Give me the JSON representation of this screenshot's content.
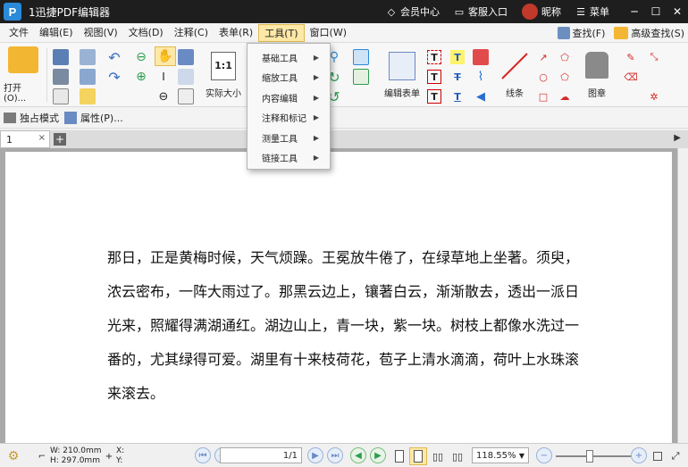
{
  "titlebar": {
    "app_title": "1迅捷PDF编辑器",
    "member_center": "会员中心",
    "customer_service": "客服入口",
    "nickname": "昵称",
    "menu_label": "菜单",
    "minimize": "─",
    "restore": "☐",
    "close": "✕"
  },
  "menubar": {
    "items": [
      "文件",
      "编辑(E)",
      "视图(V)",
      "文档(D)",
      "注释(C)",
      "表单(R)",
      "工具(T)",
      "窗口(W)"
    ],
    "find": "查找(F)",
    "advanced_find": "高级查找(S)"
  },
  "ribbon": {
    "open_label": "打开(O)...",
    "actual_size": "实际大小",
    "actual_size_icon_text": "1:1",
    "edit_form": "编辑表单",
    "line": "线条",
    "stamp": "图章"
  },
  "secondbar": {
    "exclusive_mode": "独占模式",
    "properties": "属性(P)..."
  },
  "tabs": {
    "doc_tab": "1",
    "close": "×",
    "add": "+"
  },
  "tools_menu": {
    "items": [
      "基础工具",
      "缩放工具",
      "内容编辑",
      "注释和标记",
      "测量工具",
      "链接工具"
    ]
  },
  "document": {
    "paragraph": "那日，正是黄梅时候，天气烦躁。王冕放牛倦了，在绿草地上坐著。须臾，浓云密布，一阵大雨过了。那黑云边上，镶著白云，渐渐散去，透出一派日光来，照耀得满湖通红。湖边山上，青一块，紫一块。树枝上都像水洗过一番的，尤其绿得可爱。湖里有十来枝荷花，苞子上清水滴滴，荷叶上水珠滚来滚去。"
  },
  "statusbar": {
    "width": "W: 210.0mm",
    "height": "H: 297.0mm",
    "x": "X:",
    "y": "Y:",
    "page": "1/1",
    "zoom": "118.55%"
  },
  "colors": {
    "titlebar_bg": "#1e1e1e",
    "menu_active_bg": "#fde8a6",
    "accent_blue": "#2a8ad8",
    "workspace_gray": "#a9a9a9"
  }
}
